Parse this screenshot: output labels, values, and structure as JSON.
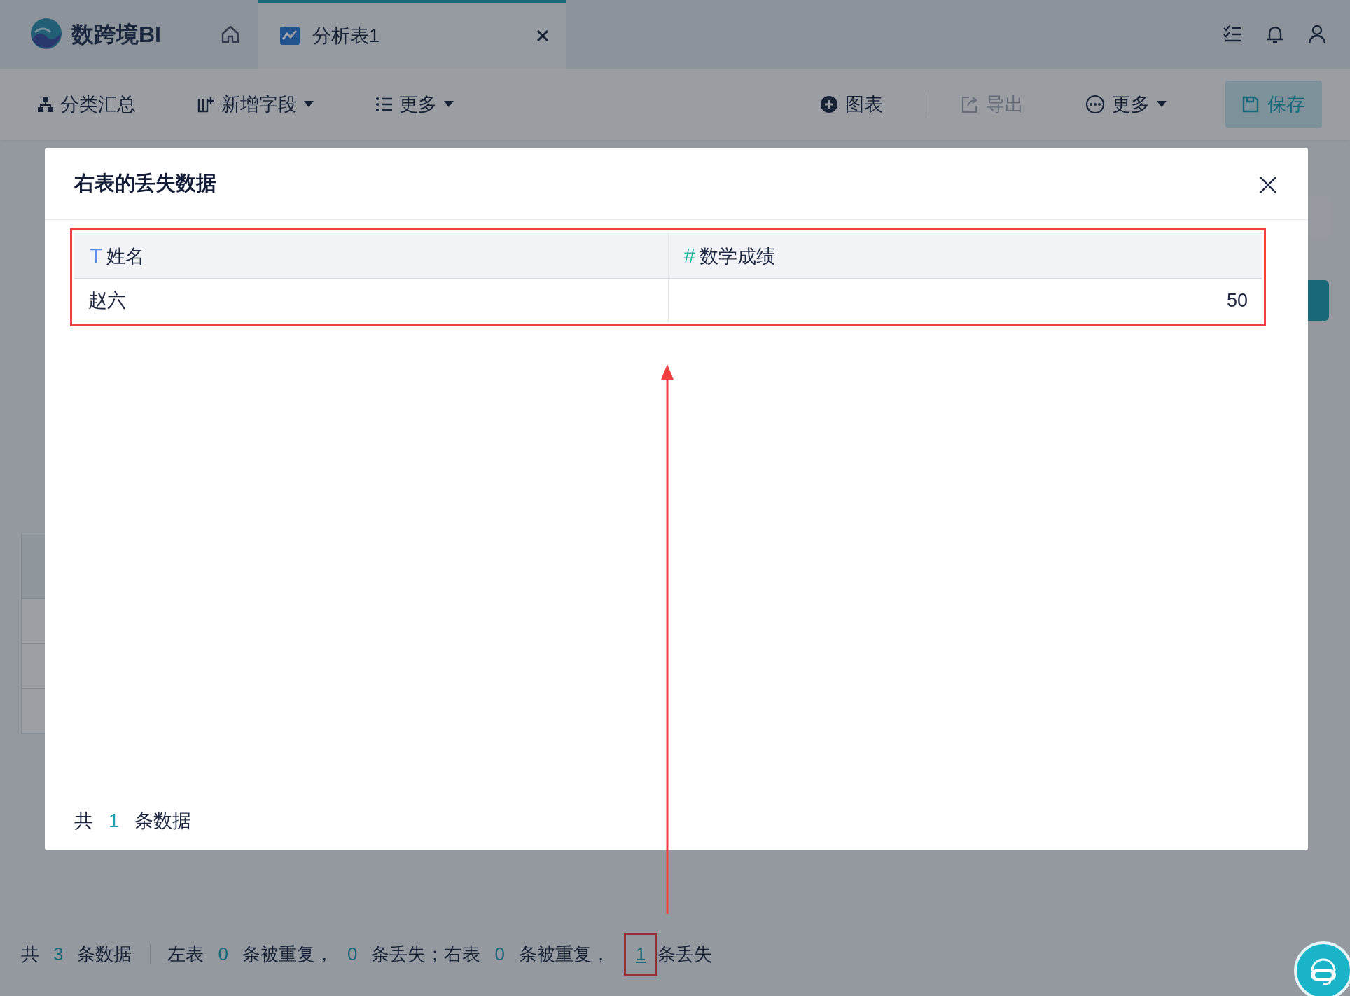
{
  "app": {
    "name": "数跨境BI"
  },
  "tabs": [
    {
      "label": "分析表1",
      "selected": true
    }
  ],
  "toolbar": {
    "left": [
      {
        "label": "分类汇总",
        "dropdown": false
      },
      {
        "label": "新增字段",
        "dropdown": true
      },
      {
        "label": "更多",
        "dropdown": true
      }
    ],
    "right": [
      {
        "label": "图表",
        "disabled": false,
        "dropdown": false
      },
      {
        "label": "导出",
        "disabled": true,
        "dropdown": false
      },
      {
        "label": "更多",
        "disabled": false,
        "dropdown": true
      }
    ],
    "save": "保存"
  },
  "modal": {
    "title": "右表的丢失数据",
    "columns": [
      {
        "label": "姓名",
        "type_mark": "T",
        "color": "#5b8def",
        "kind": "text"
      },
      {
        "label": "数学成绩",
        "type_mark": "#",
        "color": "#2bb5a0",
        "kind": "number"
      }
    ],
    "rows": [
      [
        "赵六",
        "50"
      ]
    ],
    "footer": [
      {
        "kind": "text",
        "text": "共"
      },
      {
        "kind": "count",
        "text": "1"
      },
      {
        "kind": "text",
        "text": "条数据"
      }
    ]
  },
  "status_bar": {
    "total": [
      {
        "kind": "text",
        "text": "共"
      },
      {
        "kind": "count",
        "text": "3"
      },
      {
        "kind": "text",
        "text": "条数据"
      }
    ],
    "detail": [
      {
        "kind": "text",
        "text": "左表"
      },
      {
        "kind": "count",
        "text": "0"
      },
      {
        "kind": "text",
        "text": "条被重复，"
      },
      {
        "kind": "count",
        "text": "0"
      },
      {
        "kind": "text",
        "text": "条丢失；右表"
      },
      {
        "kind": "count",
        "text": "0"
      },
      {
        "kind": "text",
        "text": "条被重复，"
      },
      {
        "kind": "link",
        "text": "1"
      },
      {
        "kind": "text",
        "text": "条丢失"
      }
    ]
  }
}
